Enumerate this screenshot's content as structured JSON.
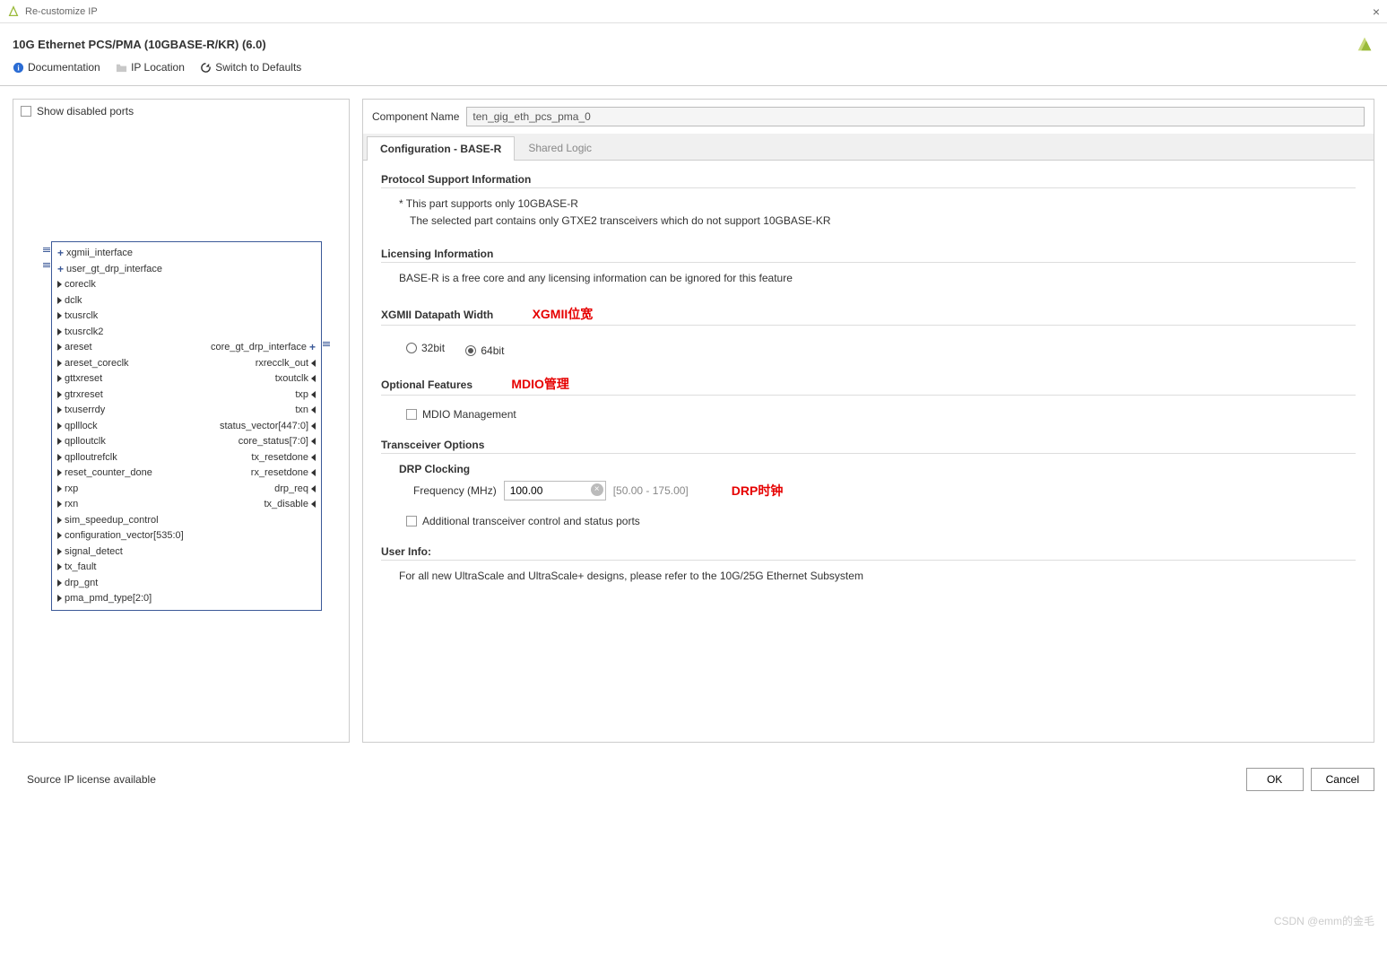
{
  "titlebar": {
    "title": "Re-customize IP",
    "close": "×"
  },
  "header": {
    "ip_title": "10G Ethernet PCS/PMA (10GBASE-R/KR) (6.0)"
  },
  "toolbar": {
    "doc": "Documentation",
    "loc": "IP Location",
    "defaults": "Switch to Defaults"
  },
  "left": {
    "show_disabled": "Show disabled ports",
    "ports_left": [
      "xgmii_interface",
      "user_gt_drp_interface",
      "coreclk",
      "dclk",
      "txusrclk",
      "txusrclk2",
      "areset",
      "areset_coreclk",
      "gttxreset",
      "gtrxreset",
      "txuserrdy",
      "qplllock",
      "qplloutclk",
      "qplloutrefclk",
      "reset_counter_done",
      "rxp",
      "rxn",
      "sim_speedup_control",
      "configuration_vector[535:0]",
      "signal_detect",
      "tx_fault",
      "drp_gnt",
      "pma_pmd_type[2:0]"
    ],
    "ports_right": [
      "",
      "",
      "",
      "",
      "",
      "",
      "core_gt_drp_interface",
      "rxrecclk_out",
      "txoutclk",
      "txp",
      "txn",
      "status_vector[447:0]",
      "core_status[7:0]",
      "tx_resetdone",
      "rx_resetdone",
      "drp_req",
      "tx_disable",
      "",
      "",
      "",
      "",
      "",
      ""
    ]
  },
  "right": {
    "comp_label": "Component Name",
    "comp_value": "ten_gig_eth_pcs_pma_0",
    "tabs": {
      "config": "Configuration - BASE-R",
      "shared": "Shared Logic"
    },
    "protocol": {
      "title": "Protocol Support Information",
      "line1": "* This part supports only 10GBASE-R",
      "line2": "The selected part contains only GTXE2 transceivers which do not support 10GBASE-KR"
    },
    "licensing": {
      "title": "Licensing Information",
      "line": "BASE-R is a free core and any licensing information can be ignored for this feature"
    },
    "xgmii": {
      "title": "XGMII Datapath Width",
      "ann": "XGMII位宽",
      "opt32": "32bit",
      "opt64": "64bit"
    },
    "optional": {
      "title": "Optional Features",
      "ann": "MDIO管理",
      "mdio": "MDIO Management"
    },
    "transceiver": {
      "title": "Transceiver Options",
      "drp_title": "DRP Clocking",
      "freq_label": "Frequency (MHz)",
      "freq_value": "100.00",
      "range": "[50.00 - 175.00]",
      "ann": "DRP时钟",
      "additional": "Additional transceiver control and status ports"
    },
    "userinfo": {
      "title": "User Info:",
      "line": "For all new UltraScale and UltraScale+ designs, please refer to the 10G/25G Ethernet Subsystem"
    }
  },
  "footer": {
    "status": "Source IP license available",
    "ok": "OK",
    "cancel": "Cancel"
  },
  "watermark": "CSDN @emm的金毛"
}
